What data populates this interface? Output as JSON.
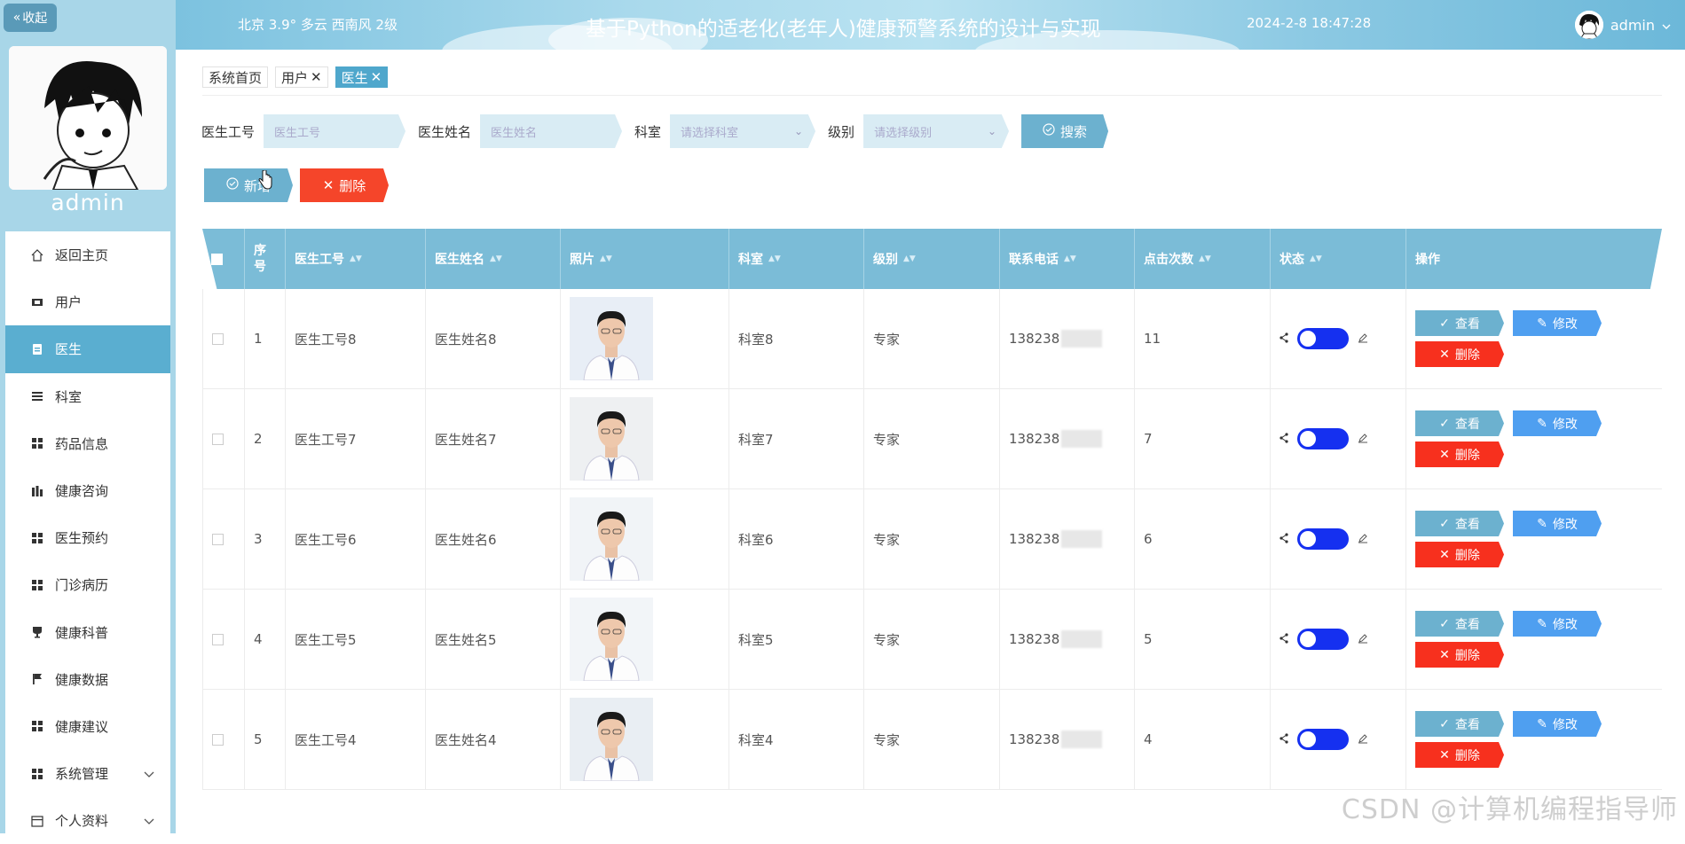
{
  "sidebar": {
    "collapse_label": "收起",
    "username": "admin",
    "menu": [
      {
        "label": "返回主页",
        "icon": "home-icon"
      },
      {
        "label": "用户",
        "icon": "user-icon"
      },
      {
        "label": "医生",
        "icon": "doctor-icon",
        "active": true
      },
      {
        "label": "科室",
        "icon": "list-icon"
      },
      {
        "label": "药品信息",
        "icon": "grid-icon"
      },
      {
        "label": "健康咨询",
        "icon": "chart-icon"
      },
      {
        "label": "医生预约",
        "icon": "grid-icon"
      },
      {
        "label": "门诊病历",
        "icon": "grid-icon"
      },
      {
        "label": "健康科普",
        "icon": "cup-icon"
      },
      {
        "label": "健康数据",
        "icon": "flag-icon"
      },
      {
        "label": "健康建议",
        "icon": "grid-icon"
      },
      {
        "label": "系统管理",
        "icon": "grid-icon",
        "expandable": true
      },
      {
        "label": "个人资料",
        "icon": "calendar-icon",
        "expandable": true
      }
    ]
  },
  "header": {
    "weather": "北京  3.9°  多云  西南风  2级",
    "title": "基于Python的适老化(老年人)健康预警系统的设计与实现",
    "datetime": "2024-2-8 18:47:28",
    "user": "admin"
  },
  "tabs": [
    {
      "label": "系统首页",
      "closable": false,
      "active": false
    },
    {
      "label": "用户",
      "closable": true,
      "active": false
    },
    {
      "label": "医生",
      "closable": true,
      "active": true
    }
  ],
  "search": {
    "fields": [
      {
        "label": "医生工号",
        "placeholder": "医生工号",
        "type": "input"
      },
      {
        "label": "医生姓名",
        "placeholder": "医生姓名",
        "type": "input"
      },
      {
        "label": "科室",
        "placeholder": "请选择科室",
        "type": "select"
      },
      {
        "label": "级别",
        "placeholder": "请选择级别",
        "type": "select"
      }
    ],
    "button": "搜索"
  },
  "actions": {
    "add": "新增",
    "delete": "删除"
  },
  "table": {
    "columns": [
      "序号",
      "医生工号",
      "医生姓名",
      "照片",
      "科室",
      "级别",
      "联系电话",
      "点击次数",
      "状态",
      "操作"
    ],
    "op_labels": {
      "view": "查看",
      "edit": "修改",
      "delete": "删除"
    },
    "rows": [
      {
        "index": "1",
        "doctor_no": "医生工号8",
        "doctor_name": "医生姓名8",
        "dept": "科室8",
        "level": "专家",
        "phone": "138238",
        "clicks": "11"
      },
      {
        "index": "2",
        "doctor_no": "医生工号7",
        "doctor_name": "医生姓名7",
        "dept": "科室7",
        "level": "专家",
        "phone": "138238",
        "clicks": "7"
      },
      {
        "index": "3",
        "doctor_no": "医生工号6",
        "doctor_name": "医生姓名6",
        "dept": "科室6",
        "level": "专家",
        "phone": "138238",
        "clicks": "6"
      },
      {
        "index": "4",
        "doctor_no": "医生工号5",
        "doctor_name": "医生姓名5",
        "dept": "科室5",
        "level": "专家",
        "phone": "138238",
        "clicks": "5"
      },
      {
        "index": "5",
        "doctor_no": "医生工号4",
        "doctor_name": "医生姓名4",
        "dept": "科室4",
        "level": "专家",
        "phone": "138238",
        "clicks": "4"
      }
    ]
  },
  "watermark": "CSDN @计算机编程指导师",
  "colors": {
    "accent": "#6cb1cf",
    "danger": "#f5452a",
    "edit": "#4f9ff0",
    "toggle": "#1530f0",
    "sidebar": "#a8d6e8"
  }
}
